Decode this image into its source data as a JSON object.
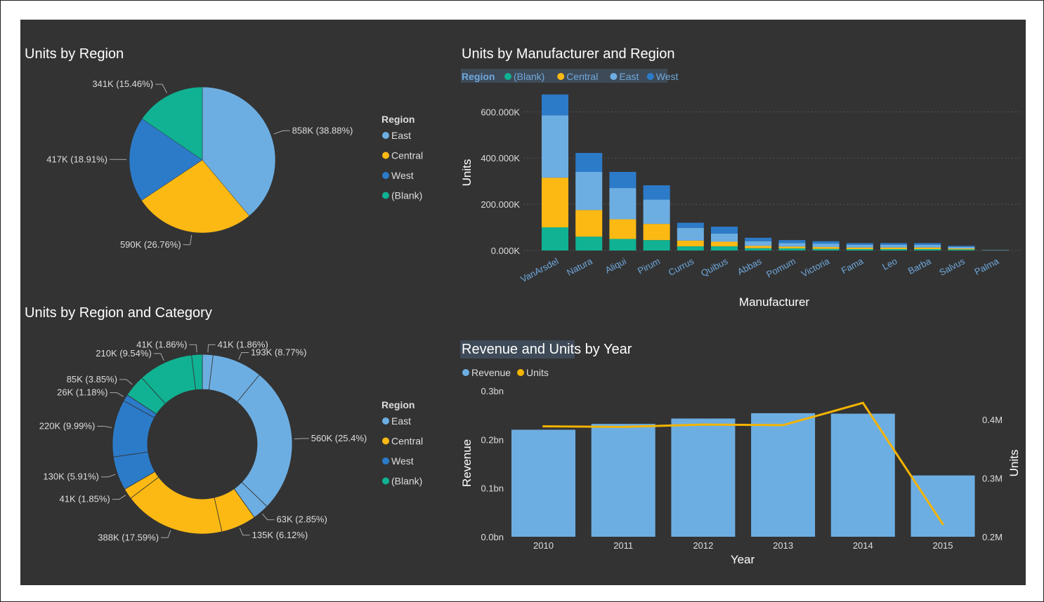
{
  "colors": {
    "east": "#6daee2",
    "central": "#fdb913",
    "west": "#2c7bc9",
    "blank": "#10b293",
    "line": "#f4b400",
    "bg": "#333333"
  },
  "chart_data": [
    {
      "type": "pie",
      "title": "Units by Region",
      "legend_title": "Region",
      "legend": [
        "East",
        "Central",
        "West",
        "(Blank)"
      ],
      "slices": [
        {
          "name": "East",
          "value": 858,
          "label": "858K (38.88%)",
          "color": "#6daee2"
        },
        {
          "name": "Central",
          "value": 590,
          "label": "590K (26.76%)",
          "color": "#fdb913"
        },
        {
          "name": "West",
          "value": 417,
          "label": "417K (18.91%)",
          "color": "#2c7bc9"
        },
        {
          "name": "(Blank)",
          "value": 341,
          "label": "341K (15.46%)",
          "color": "#10b293"
        }
      ]
    },
    {
      "type": "bar",
      "stacked": true,
      "title": "Units by Manufacturer and Region",
      "legend_title": "Region",
      "legend": [
        "(Blank)",
        "Central",
        "East",
        "West"
      ],
      "xlabel": "Manufacturer",
      "ylabel": "Units",
      "ylim": [
        0,
        680000
      ],
      "yticks": [
        "0.000K",
        "200.000K",
        "400.000K",
        "600.000K"
      ],
      "categories": [
        "VanArsdel",
        "Natura",
        "Aliqui",
        "Pirum",
        "Currus",
        "Quibus",
        "Abbas",
        "Pomum",
        "Victoria",
        "Fama",
        "Leo",
        "Barba",
        "Salvus",
        "Palma"
      ],
      "series": [
        {
          "name": "(Blank)",
          "color": "#10b293",
          "values": [
            100000,
            60000,
            50000,
            45000,
            18000,
            18000,
            10000,
            9000,
            7000,
            6000,
            6000,
            6000,
            5000,
            500
          ]
        },
        {
          "name": "Central",
          "color": "#fdb913",
          "values": [
            215000,
            115000,
            85000,
            70000,
            25000,
            20000,
            10000,
            8000,
            8000,
            7000,
            7000,
            7000,
            4000,
            500
          ]
        },
        {
          "name": "East",
          "color": "#6daee2",
          "values": [
            270000,
            165000,
            135000,
            105000,
            55000,
            35000,
            20000,
            15000,
            15000,
            12000,
            12000,
            12000,
            7000,
            1000
          ]
        },
        {
          "name": "West",
          "color": "#2c7bc9",
          "values": [
            90000,
            82000,
            70000,
            62000,
            22000,
            30000,
            15000,
            13000,
            10000,
            7000,
            7000,
            7000,
            4000,
            1000
          ]
        }
      ]
    },
    {
      "type": "pie",
      "donut": true,
      "title": "Units by Region and Category",
      "legend_title": "Region",
      "legend": [
        "East",
        "Central",
        "West",
        "(Blank)"
      ],
      "slices": [
        {
          "value": 41,
          "label": "41K (1.86%)",
          "color": "#6daee2"
        },
        {
          "value": 193,
          "label": "193K (8.77%)",
          "color": "#6daee2"
        },
        {
          "value": 560,
          "label": "560K (25.4%)",
          "color": "#6daee2"
        },
        {
          "value": 63,
          "label": "63K (2.85%)",
          "color": "#6daee2"
        },
        {
          "value": 135,
          "label": "135K (6.12%)",
          "color": "#fdb913"
        },
        {
          "value": 388,
          "label": "388K (17.59%)",
          "color": "#fdb913"
        },
        {
          "value": 41,
          "label": "41K (1.85%)",
          "color": "#fdb913"
        },
        {
          "value": 130,
          "label": "130K (5.91%)",
          "color": "#2c7bc9"
        },
        {
          "value": 220,
          "label": "220K (9.99%)",
          "color": "#2c7bc9"
        },
        {
          "value": 26,
          "label": "26K (1.18%)",
          "color": "#2c7bc9"
        },
        {
          "value": 85,
          "label": "85K (3.85%)",
          "color": "#10b293"
        },
        {
          "value": 210,
          "label": "210K (9.54%)",
          "color": "#10b293"
        },
        {
          "value": 41,
          "label": "41K (1.86%)",
          "color": "#10b293"
        }
      ]
    },
    {
      "type": "bar",
      "combo_line": true,
      "title": "Revenue and Units by Year",
      "legend": [
        "Revenue",
        "Units"
      ],
      "xlabel": "Year",
      "ylabel": "Revenue",
      "y2label": "Units",
      "categories": [
        "2010",
        "2011",
        "2012",
        "2013",
        "2014",
        "2015"
      ],
      "ylim": [
        0,
        0.3
      ],
      "yticks": [
        "0.0bn",
        "0.1bn",
        "0.2bn",
        "0.3bn"
      ],
      "y2lim": [
        0.2,
        0.4
      ],
      "y2ticks": [
        "0.2M",
        "0.3M",
        "0.4M"
      ],
      "series": [
        {
          "name": "Revenue",
          "color": "#6daee2",
          "values": [
            0.22,
            0.232,
            0.243,
            0.254,
            0.253,
            0.126
          ]
        },
        {
          "name": "Units",
          "color": "#f4b400",
          "values": [
            0.3885,
            0.3875,
            0.3915,
            0.3905,
            0.4285,
            0.2215
          ]
        }
      ]
    }
  ]
}
